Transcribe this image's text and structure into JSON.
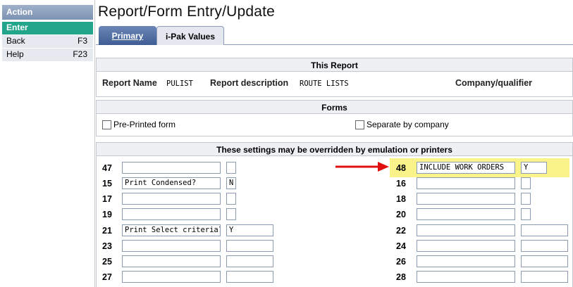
{
  "sidebar": {
    "header": "Action",
    "items": [
      {
        "label": "Enter",
        "key": ""
      },
      {
        "label": "Back",
        "key": "F3"
      },
      {
        "label": "Help",
        "key": "F23"
      }
    ]
  },
  "page": {
    "title": "Report/Form Entry/Update"
  },
  "tabs": [
    {
      "label": "Primary"
    },
    {
      "label": "i-Pak Values"
    }
  ],
  "this_report": {
    "header": "This Report",
    "report_name_label": "Report Name",
    "report_name": "PULIST",
    "report_desc_label": "Report description",
    "report_desc": "ROUTE LISTS",
    "company_label": "Company/qualifier"
  },
  "forms": {
    "header": "Forms",
    "preprinted_label": "Pre-Printed form",
    "separate_label": "Separate by company"
  },
  "settings": {
    "header": "These settings may be overridden by emulation or printers",
    "left": [
      {
        "num": "47",
        "text": "",
        "val": ""
      },
      {
        "num": "15",
        "text": "Print Condensed?",
        "val": "N"
      },
      {
        "num": "17",
        "text": "",
        "val": ""
      },
      {
        "num": "19",
        "text": "",
        "val": ""
      },
      {
        "num": "21",
        "text": "Print Select criteria?",
        "val": "Y"
      },
      {
        "num": "23",
        "text": "",
        "val": ""
      },
      {
        "num": "25",
        "text": "",
        "val": ""
      },
      {
        "num": "27",
        "text": "",
        "val": ""
      }
    ],
    "right": [
      {
        "num": "48",
        "text": "INCLUDE WORK ORDERS",
        "val": "Y"
      },
      {
        "num": "16",
        "text": "",
        "val": ""
      },
      {
        "num": "18",
        "text": "",
        "val": ""
      },
      {
        "num": "20",
        "text": "",
        "val": ""
      },
      {
        "num": "22",
        "text": "",
        "val": ""
      },
      {
        "num": "24",
        "text": "",
        "val": ""
      },
      {
        "num": "26",
        "text": "",
        "val": ""
      },
      {
        "num": "28",
        "text": "",
        "val": ""
      }
    ]
  },
  "colors": {
    "highlight": "#faf38a",
    "arrow": "#e01010",
    "enter_bg": "#22a58a"
  }
}
